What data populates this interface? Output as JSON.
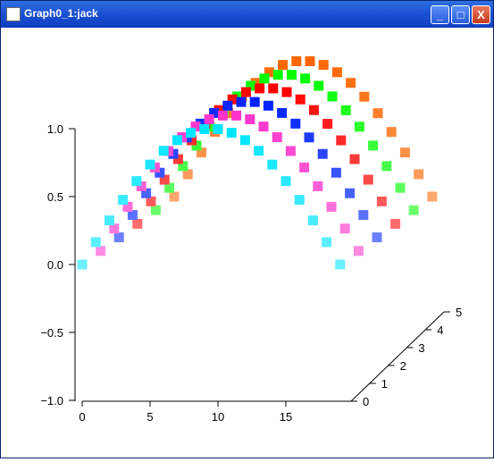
{
  "window": {
    "title": "Graph0_1:jack",
    "minimize_glyph": "_",
    "maximize_glyph": "□",
    "close_glyph": "X"
  },
  "chart_data": {
    "type": "scatter",
    "title": "",
    "xlabel": "",
    "ylabel": "",
    "zlabel": "",
    "x_ticks": [
      "0",
      "5",
      "10",
      "15"
    ],
    "y_ticks": [
      "1.0",
      "0.5",
      "0.0",
      "−0.5",
      "−1.0"
    ],
    "z_ticks": [
      "0",
      "1",
      "2",
      "3",
      "4",
      "5"
    ],
    "xlim": [
      0,
      19.5
    ],
    "ylim": [
      -1.0,
      1.0
    ],
    "zlim": [
      0,
      5
    ],
    "grid": false,
    "legend": "none",
    "projection": "3d-waterfall",
    "x_values": [
      0,
      1,
      2,
      3,
      4,
      5,
      6,
      7,
      8,
      9,
      10,
      11,
      12,
      13,
      14,
      15,
      16,
      17,
      18,
      19
    ],
    "formula": "sin(pi*x/19)",
    "series": [
      {
        "z": 0,
        "color": "#00e5ff"
      },
      {
        "z": 1,
        "color": "#ff33cc"
      },
      {
        "z": 2,
        "color": "#0022ff"
      },
      {
        "z": 3,
        "color": "#ff0000"
      },
      {
        "z": 4,
        "color": "#00ff00"
      },
      {
        "z": 5,
        "color": "#ff6600"
      }
    ]
  }
}
